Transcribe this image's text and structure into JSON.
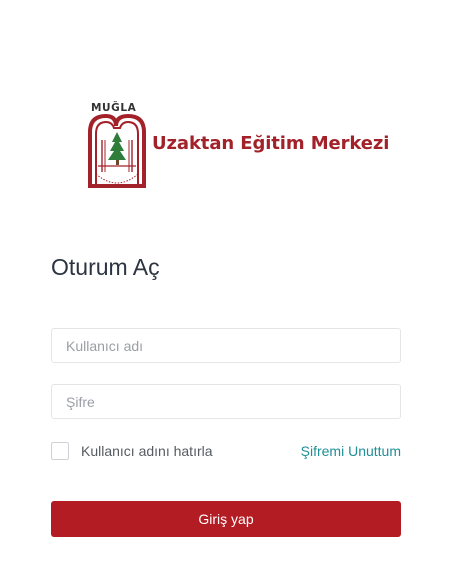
{
  "logo": {
    "top_word": "MUĞLA",
    "title": "Uzaktan Eğitim Merkezi",
    "brand_color": "#a3222a"
  },
  "login": {
    "heading": "Oturum Aç",
    "username_placeholder": "Kullanıcı adı",
    "password_placeholder": "Şifre",
    "remember_label": "Kullanıcı adını hatırla",
    "remember_checked": false,
    "forgot_link": "Şifremi Unuttum",
    "submit_label": "Giriş yap"
  },
  "colors": {
    "primary_button": "#b41c23",
    "link": "#1f8f96",
    "heading": "#2b3440"
  }
}
